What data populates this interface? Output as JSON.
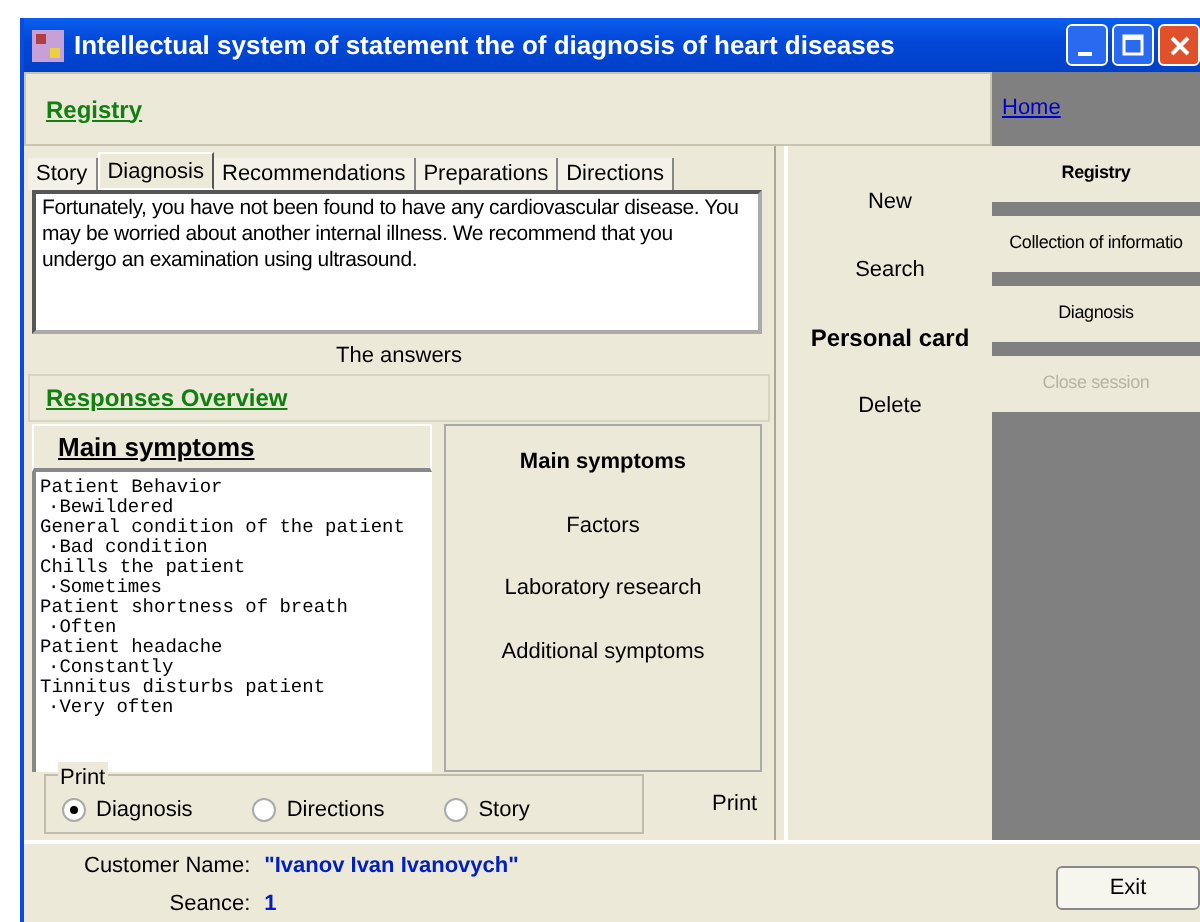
{
  "window": {
    "title": "Intellectual system of statement the of diagnosis of heart diseases"
  },
  "header": {
    "link": "Registry"
  },
  "tabs": [
    {
      "label": "Story",
      "selected": false
    },
    {
      "label": "Diagnosis",
      "selected": true
    },
    {
      "label": "Recommendations",
      "selected": false
    },
    {
      "label": "Preparations",
      "selected": false
    },
    {
      "label": "Directions",
      "selected": false
    }
  ],
  "diagnosis_text": "Fortunately, you have not been found to have any cardiovascular disease. You may be worried about another internal illness. We recommend that you undergo an examination using ultrasound.",
  "answers_caption": "The answers",
  "responses_link": "Responses Overview",
  "symptoms_heading": "Main symptoms",
  "symptoms": [
    {
      "label": "Patient Behavior",
      "children": [
        {
          "label": "·Bewildered"
        }
      ]
    },
    {
      "label": "General condition of the patient",
      "children": [
        {
          "label": "·Bad condition"
        }
      ]
    },
    {
      "label": "Chills the patient",
      "children": [
        {
          "label": "·Sometimes"
        }
      ]
    },
    {
      "label": "Patient shortness of breath",
      "children": [
        {
          "label": "·Often"
        }
      ]
    },
    {
      "label": "Patient headache",
      "children": [
        {
          "label": "·Constantly"
        }
      ]
    },
    {
      "label": "Tinnitus disturbs patient",
      "children": [
        {
          "label": "·Very often"
        }
      ]
    }
  ],
  "categories": [
    {
      "label": "Main symptoms",
      "selected": true
    },
    {
      "label": "Factors",
      "selected": false
    },
    {
      "label": "Laboratory research",
      "selected": false
    },
    {
      "label": "Additional symptoms",
      "selected": false
    }
  ],
  "print": {
    "legend": "Print",
    "options": [
      {
        "label": "Diagnosis",
        "checked": true
      },
      {
        "label": "Directions",
        "checked": false
      },
      {
        "label": "Story",
        "checked": false
      }
    ],
    "button": "Print"
  },
  "actions": [
    {
      "label": "New",
      "selected": false
    },
    {
      "label": "Search",
      "selected": false
    },
    {
      "label": "Personal card",
      "selected": true
    },
    {
      "label": "Delete",
      "selected": false
    }
  ],
  "sidebar": {
    "home": "Home",
    "items": [
      {
        "label": "Registry",
        "selected": true,
        "disabled": false
      },
      {
        "label": "Collection of informatio",
        "selected": false,
        "disabled": false
      },
      {
        "label": "Diagnosis",
        "selected": false,
        "disabled": false
      },
      {
        "label": "Close session",
        "selected": false,
        "disabled": true
      }
    ]
  },
  "status": {
    "customer_label": "Customer Name:",
    "customer_value": "\"Ivanov Ivan Ivanovych\"",
    "seance_label": "Seance:",
    "seance_value": "1",
    "exit": "Exit"
  }
}
